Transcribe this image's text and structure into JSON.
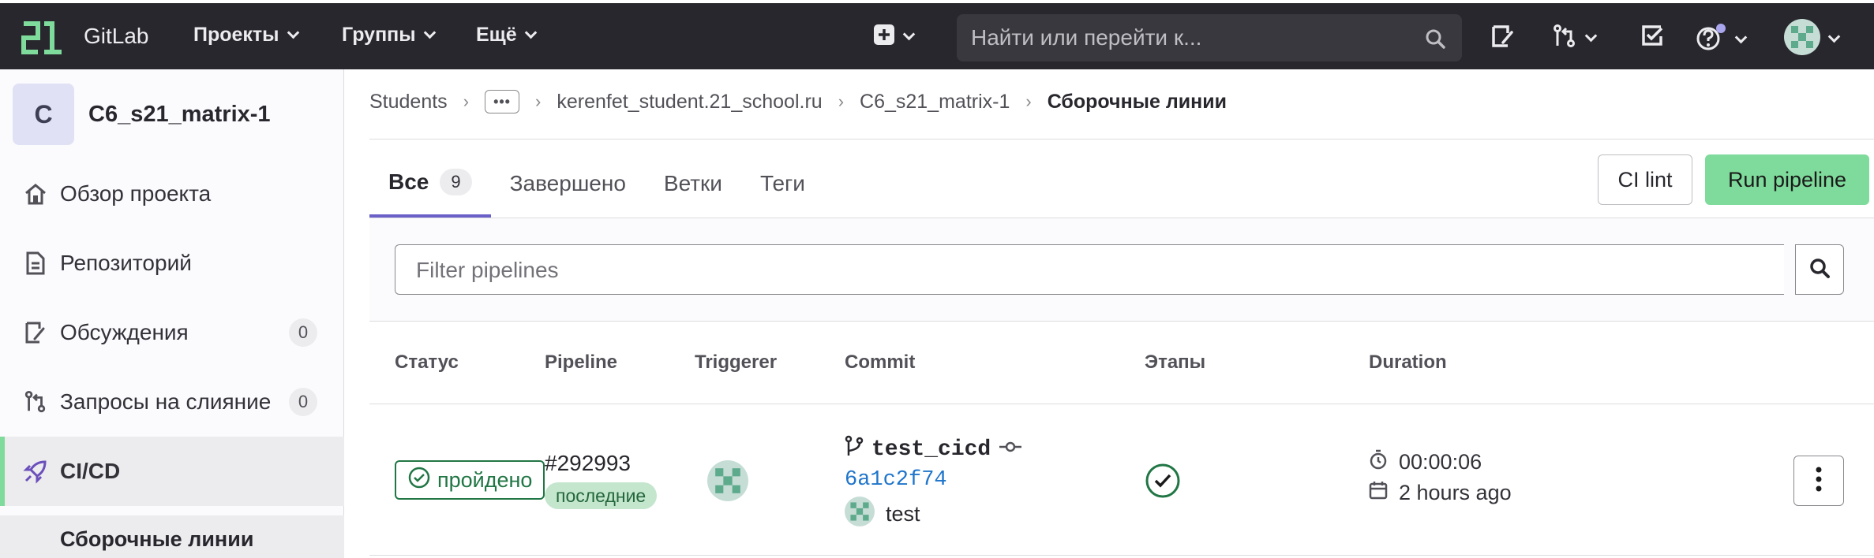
{
  "topbar": {
    "brand": "GitLab",
    "nav": [
      {
        "label": "Проекты"
      },
      {
        "label": "Группы"
      },
      {
        "label": "Ещё"
      }
    ],
    "search_placeholder": "Найти или перейти к..."
  },
  "sidebar": {
    "project_avatar": "C",
    "project_name": "C6_s21_matrix-1",
    "items": [
      {
        "label": "Обзор проекта",
        "icon": "home-icon"
      },
      {
        "label": "Репозиторий",
        "icon": "document-icon"
      },
      {
        "label": "Обсуждения",
        "icon": "issues-icon",
        "count": "0"
      },
      {
        "label": "Запросы на слияние",
        "icon": "merge-request-icon",
        "count": "0"
      },
      {
        "label": "CI/CD",
        "icon": "rocket-icon"
      }
    ],
    "sub_item": "Сборочные линии"
  },
  "breadcrumb": {
    "items": [
      "Students",
      "kerenfet_student.21_school.ru",
      "C6_s21_matrix-1"
    ],
    "current": "Сборочные линии"
  },
  "tabs": [
    {
      "label": "Все",
      "count": "9"
    },
    {
      "label": "Завершено"
    },
    {
      "label": "Ветки"
    },
    {
      "label": "Теги"
    }
  ],
  "buttons": {
    "ci_lint": "CI lint",
    "run_pipeline": "Run pipeline"
  },
  "filter": {
    "placeholder": "Filter pipelines"
  },
  "table": {
    "headers": [
      "Статус",
      "Pipeline",
      "Triggerer",
      "Commit",
      "Этапы",
      "Duration"
    ],
    "rows": [
      {
        "status": "пройдено",
        "pipeline_id": "#292993",
        "pipeline_tag": "последние",
        "commit_ref": "test_cicd",
        "commit_sha": "6a1c2f74",
        "commit_author": "test",
        "duration": "00:00:06",
        "finished": "2 hours ago"
      }
    ]
  },
  "colors": {
    "topbar_bg": "#28272d",
    "success": "#217645",
    "run_button": "#7fdb9b",
    "active_tab": "#6b60c8",
    "link": "#1f75cb"
  }
}
